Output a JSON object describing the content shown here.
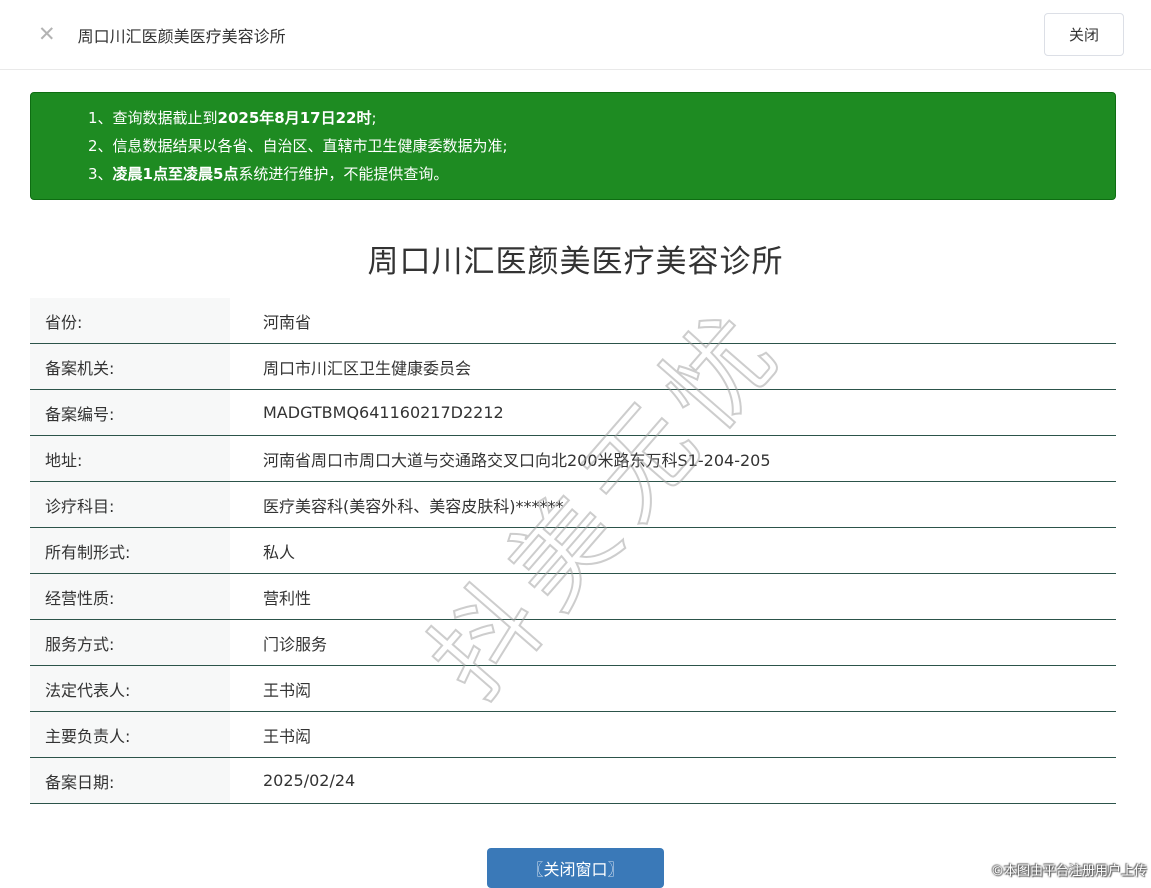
{
  "header": {
    "title": "周口川汇医颜美医疗美容诊所",
    "close_icon": "✕",
    "close_button_label": "关闭"
  },
  "notice": {
    "items": [
      {
        "pre": "1、查询数据截止到",
        "bold": "2025年8月17日22时",
        "post": ";"
      },
      {
        "pre": "2、信息数据结果以各省、自治区、直辖市卫生健康委数据为准;",
        "bold": "",
        "post": ""
      },
      {
        "pre": "3、",
        "bold": "凌晨1点至凌晨5点",
        "post": "系统进行维护，不能提供查询。"
      }
    ]
  },
  "main": {
    "title": "周口川汇医颜美医疗美容诊所",
    "rows": [
      {
        "label": "省份:",
        "value": "河南省"
      },
      {
        "label": "备案机关:",
        "value": "周口市川汇区卫生健康委员会"
      },
      {
        "label": "备案编号:",
        "value": "MADGTBMQ641160217D2212"
      },
      {
        "label": "地址:",
        "value": "河南省周口市周口大道与交通路交叉口向北200米路东万科S1-204-205"
      },
      {
        "label": "诊疗科目:",
        "value": "医疗美容科(美容外科、美容皮肤科)******"
      },
      {
        "label": "所有制形式:",
        "value": "私人"
      },
      {
        "label": "经营性质:",
        "value": "营利性"
      },
      {
        "label": "服务方式:",
        "value": "门诊服务"
      },
      {
        "label": "法定代表人:",
        "value": "王书闳"
      },
      {
        "label": "主要负责人:",
        "value": "王书闳"
      },
      {
        "label": "备案日期:",
        "value": "2025/02/24"
      }
    ],
    "close_window_button": "〖关闭窗口〗"
  },
  "watermark": {
    "diagonal_text": "抖美无忧",
    "credit_text": "©本图由平台注册用户上传"
  },
  "colors": {
    "notice_green": "#1e8b22",
    "notice_green_border": "#0e6d12",
    "row_divider": "#2c544a",
    "button_blue": "#3a79b8"
  }
}
